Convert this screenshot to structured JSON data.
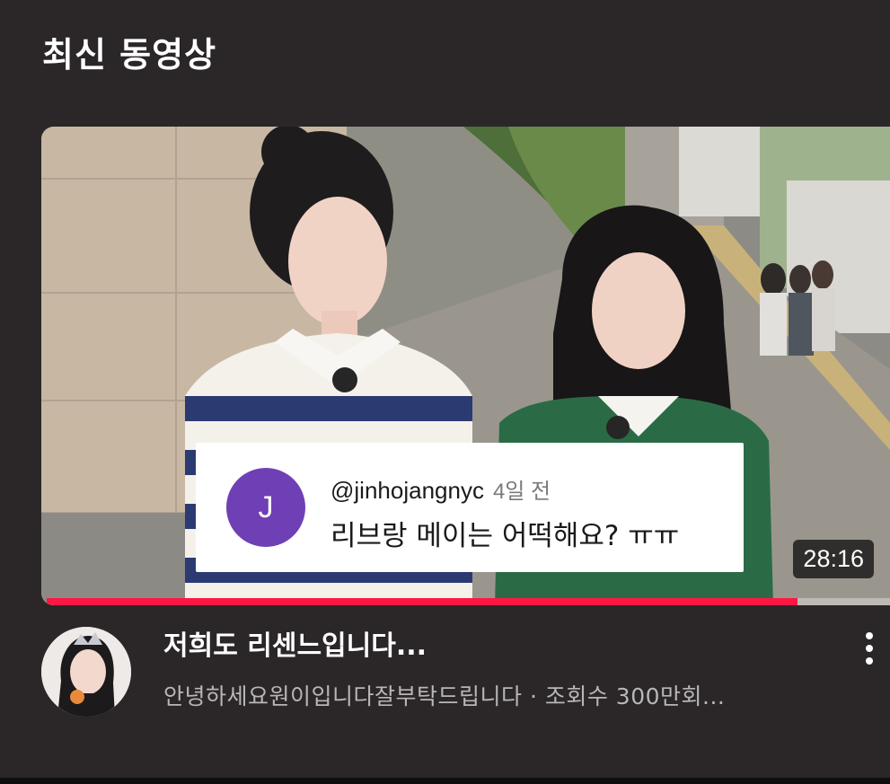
{
  "section": {
    "title": "최신 동영상"
  },
  "video": {
    "duration": "28:16",
    "progress_fraction": 0.89,
    "title": "저희도 리센느입니다...",
    "meta": "안녕하세요원이입니다잘부탁드립니다 · 조회수 300만회...",
    "comment": {
      "avatar_letter": "J",
      "handle": "@jinhojangnyc",
      "time": "4일 전",
      "text": "리브랑 메이는 어떡해요? ㅠㅠ"
    }
  },
  "icons": {
    "more": "more-vert-icon"
  },
  "colors": {
    "background": "#2b2728",
    "progress": "#ff1744",
    "comment_avatar": "#6f3fb6",
    "meta_text": "#b9b6b6"
  }
}
